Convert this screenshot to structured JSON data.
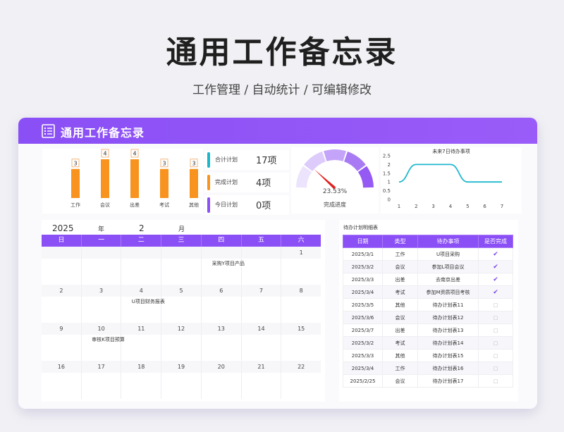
{
  "page": {
    "title": "通用工作备忘录",
    "subtitle": "工作管理 / 自动统计 /  可编辑修改"
  },
  "card": {
    "title": "通用工作备忘录",
    "icon": "list-icon"
  },
  "colors": {
    "accent": "#8b4ff6",
    "bar": "#f7931e",
    "kpi_total": "#1cb5c9",
    "kpi_done": "#f7931e",
    "kpi_today": "#8b4ff6",
    "line": "#22b8cf",
    "check": "#7a45e8"
  },
  "chart_data": [
    {
      "type": "bar",
      "categories": [
        "工作",
        "会议",
        "出差",
        "考试",
        "其他"
      ],
      "values": [
        3,
        4,
        4,
        3,
        3
      ],
      "ylim": [
        0,
        4
      ]
    },
    {
      "type": "gauge",
      "value_percent": 23.53,
      "value_label": "23.53%",
      "label": "完成进度"
    },
    {
      "type": "line",
      "title": "未来7日待办事项",
      "x": [
        1,
        2,
        3,
        4,
        5,
        6,
        7
      ],
      "values": [
        1,
        2,
        2,
        2,
        1,
        1,
        1
      ],
      "ylim": [
        0,
        2.5
      ],
      "yticks": [
        "0",
        "0.5",
        "1",
        "1.5",
        "2",
        "2.5"
      ],
      "xticks": [
        "1",
        "2",
        "3",
        "4",
        "5",
        "6",
        "7"
      ]
    }
  ],
  "kpis": [
    {
      "label": "合计计划",
      "value": "17项"
    },
    {
      "label": "完成计划",
      "value": "4项"
    },
    {
      "label": "今日计划",
      "value": "0项"
    }
  ],
  "calendar": {
    "year": "2025",
    "year_unit": "年",
    "month": "2",
    "month_unit": "月",
    "weekdays": [
      "日",
      "一",
      "二",
      "三",
      "四",
      "五",
      "六"
    ],
    "weeks": [
      {
        "days": [
          "",
          "",
          "",
          "",
          "",
          "",
          "1"
        ],
        "events": [
          "",
          "",
          "",
          "",
          "采购Y项目产品",
          "",
          ""
        ]
      },
      {
        "days": [
          "2",
          "3",
          "4",
          "5",
          "6",
          "7",
          "8"
        ],
        "events": [
          "",
          "",
          "U项目财务报表",
          "",
          "",
          "",
          ""
        ]
      },
      {
        "days": [
          "9",
          "10",
          "11",
          "12",
          "13",
          "14",
          "15"
        ],
        "events": [
          "",
          "审核K项目预算",
          "",
          "",
          "",
          "",
          ""
        ]
      },
      {
        "days": [
          "16",
          "17",
          "18",
          "19",
          "20",
          "21",
          "22"
        ],
        "events": [
          "",
          "",
          "",
          "",
          "",
          "",
          ""
        ]
      }
    ]
  },
  "table": {
    "title": "待办计划明细表",
    "headers": [
      "日期",
      "类型",
      "待办事项",
      "是否完成"
    ],
    "rows": [
      [
        "2025/3/1",
        "工作",
        "U项目采购",
        "✔"
      ],
      [
        "2025/3/2",
        "会议",
        "参加L项目会议",
        "✔"
      ],
      [
        "2025/3/3",
        "出差",
        "去南京出差",
        "✔"
      ],
      [
        "2025/3/4",
        "考试",
        "参加M资质项目考核",
        "✔"
      ],
      [
        "2025/3/5",
        "其他",
        "待办计划表11",
        "□"
      ],
      [
        "2025/3/6",
        "会议",
        "待办计划表12",
        "□"
      ],
      [
        "2025/3/7",
        "出差",
        "待办计划表13",
        "□"
      ],
      [
        "2025/3/2",
        "考试",
        "待办计划表14",
        "□"
      ],
      [
        "2025/3/3",
        "其他",
        "待办计划表15",
        "□"
      ],
      [
        "2025/3/4",
        "工作",
        "待办计划表16",
        "□"
      ],
      [
        "2025/2/25",
        "会议",
        "待办计划表17",
        "□"
      ]
    ]
  }
}
